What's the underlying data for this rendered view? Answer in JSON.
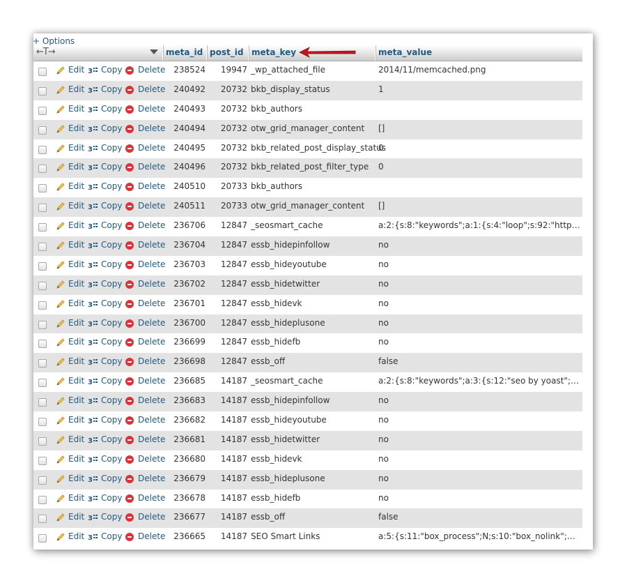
{
  "options_label": "+ Options",
  "header": {
    "arrows": "←T→",
    "columns": [
      "meta_id",
      "post_id",
      "meta_key",
      "meta_value"
    ]
  },
  "actions": {
    "edit": "Edit",
    "copy": "Copy",
    "delete": "Delete"
  },
  "rows": [
    {
      "meta_id": "238524",
      "post_id": "19947",
      "meta_key": "_wp_attached_file",
      "meta_value": "2014/11/memcached.png"
    },
    {
      "meta_id": "240492",
      "post_id": "20732",
      "meta_key": "bkb_display_status",
      "meta_value": "1"
    },
    {
      "meta_id": "240493",
      "post_id": "20732",
      "meta_key": "bkb_authors",
      "meta_value": ""
    },
    {
      "meta_id": "240494",
      "post_id": "20732",
      "meta_key": "otw_grid_manager_content",
      "meta_value": "[]"
    },
    {
      "meta_id": "240495",
      "post_id": "20732",
      "meta_key": "bkb_related_post_display_status",
      "meta_value": "0"
    },
    {
      "meta_id": "240496",
      "post_id": "20732",
      "meta_key": "bkb_related_post_filter_type",
      "meta_value": "0"
    },
    {
      "meta_id": "240510",
      "post_id": "20733",
      "meta_key": "bkb_authors",
      "meta_value": ""
    },
    {
      "meta_id": "240511",
      "post_id": "20733",
      "meta_key": "otw_grid_manager_content",
      "meta_value": "[]"
    },
    {
      "meta_id": "236706",
      "post_id": "12847",
      "meta_key": "_seosmart_cache",
      "meta_value": "a:2:{s:8:\"keywords\";a:1:{s:4:\"loop\";s:92:\"http://t..."
    },
    {
      "meta_id": "236704",
      "post_id": "12847",
      "meta_key": "essb_hidepinfollow",
      "meta_value": "no"
    },
    {
      "meta_id": "236703",
      "post_id": "12847",
      "meta_key": "essb_hideyoutube",
      "meta_value": "no"
    },
    {
      "meta_id": "236702",
      "post_id": "12847",
      "meta_key": "essb_hidetwitter",
      "meta_value": "no"
    },
    {
      "meta_id": "236701",
      "post_id": "12847",
      "meta_key": "essb_hidevk",
      "meta_value": "no"
    },
    {
      "meta_id": "236700",
      "post_id": "12847",
      "meta_key": "essb_hideplusone",
      "meta_value": "no"
    },
    {
      "meta_id": "236699",
      "post_id": "12847",
      "meta_key": "essb_hidefb",
      "meta_value": "no"
    },
    {
      "meta_id": "236698",
      "post_id": "12847",
      "meta_key": "essb_off",
      "meta_value": "false"
    },
    {
      "meta_id": "236685",
      "post_id": "14187",
      "meta_key": "_seosmart_cache",
      "meta_value": "a:2:{s:8:\"keywords\";a:3:{s:12:\"seo by yoast\";s:84:..."
    },
    {
      "meta_id": "236683",
      "post_id": "14187",
      "meta_key": "essb_hidepinfollow",
      "meta_value": "no"
    },
    {
      "meta_id": "236682",
      "post_id": "14187",
      "meta_key": "essb_hideyoutube",
      "meta_value": "no"
    },
    {
      "meta_id": "236681",
      "post_id": "14187",
      "meta_key": "essb_hidetwitter",
      "meta_value": "no"
    },
    {
      "meta_id": "236680",
      "post_id": "14187",
      "meta_key": "essb_hidevk",
      "meta_value": "no"
    },
    {
      "meta_id": "236679",
      "post_id": "14187",
      "meta_key": "essb_hideplusone",
      "meta_value": "no"
    },
    {
      "meta_id": "236678",
      "post_id": "14187",
      "meta_key": "essb_hidefb",
      "meta_value": "no"
    },
    {
      "meta_id": "236677",
      "post_id": "14187",
      "meta_key": "essb_off",
      "meta_value": "false"
    },
    {
      "meta_id": "236665",
      "post_id": "14187",
      "meta_key": "SEO Smart Links",
      "meta_value": "a:5:{s:11:\"box_process\";N;s:10:\"box_nolink\";N;s:17..."
    }
  ]
}
